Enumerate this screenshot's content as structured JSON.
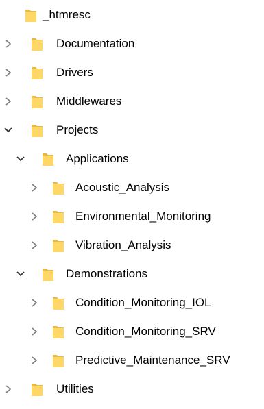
{
  "tree": {
    "items": [
      {
        "label": "_htmresc",
        "expander": "none",
        "icon": "folder-icon"
      },
      {
        "label": "Documentation",
        "expander": "collapsed",
        "icon": "folder-icon"
      },
      {
        "label": "Drivers",
        "expander": "collapsed",
        "icon": "folder-icon"
      },
      {
        "label": "Middlewares",
        "expander": "collapsed",
        "icon": "folder-icon"
      },
      {
        "label": "Projects",
        "expander": "expanded",
        "icon": "folder-icon"
      },
      {
        "label": "Applications",
        "expander": "expanded",
        "icon": "folder-icon"
      },
      {
        "label": "Acoustic_Analysis",
        "expander": "collapsed",
        "icon": "folder-icon"
      },
      {
        "label": "Environmental_Monitoring",
        "expander": "collapsed",
        "icon": "folder-icon"
      },
      {
        "label": "Vibration_Analysis",
        "expander": "collapsed",
        "icon": "folder-icon"
      },
      {
        "label": "Demonstrations",
        "expander": "expanded",
        "icon": "folder-icon"
      },
      {
        "label": "Condition_Monitoring_IOL",
        "expander": "collapsed",
        "icon": "folder-icon"
      },
      {
        "label": "Condition_Monitoring_SRV",
        "expander": "collapsed",
        "icon": "folder-icon"
      },
      {
        "label": "Predictive_Maintenance_SRV",
        "expander": "collapsed",
        "icon": "folder-icon"
      },
      {
        "label": "Utilities",
        "expander": "collapsed",
        "icon": "folder-icon"
      }
    ]
  },
  "colors": {
    "folder_body": "#FFD766",
    "folder_back": "#E9B84A",
    "chevron": "#7A7A7A",
    "text": "#000000"
  }
}
